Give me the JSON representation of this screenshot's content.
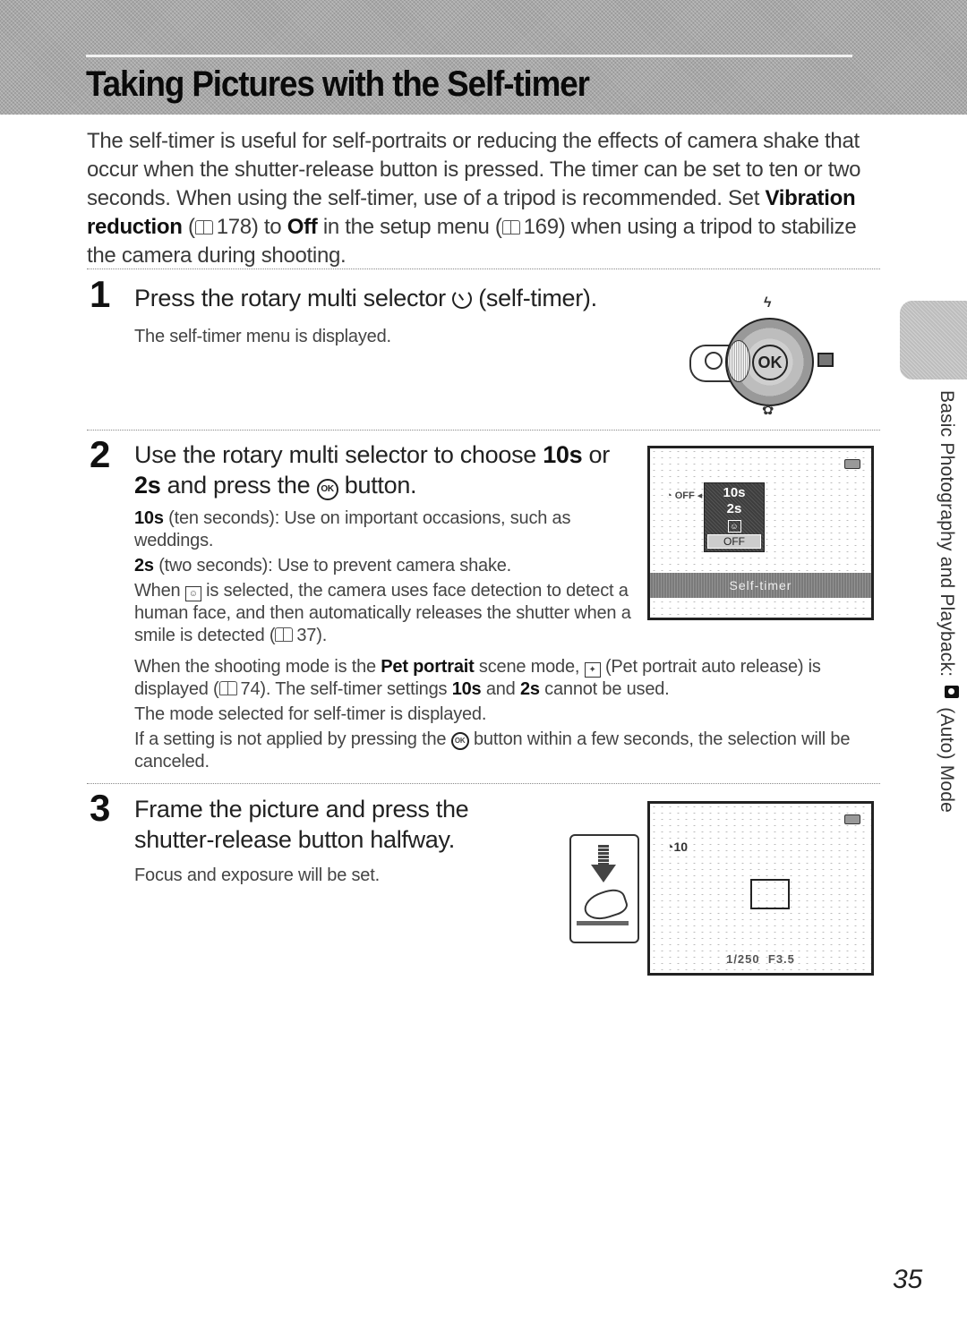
{
  "header": {
    "title": "Taking Pictures with the Self-timer"
  },
  "intro": {
    "line1": "The self-timer is useful for self-portraits or reducing the effects of camera shake that occur when the shutter-release button is pressed. The timer can be set to ten or two seconds. When using the self-timer, use of a tripod is recommended. Set ",
    "vr_label": "Vibration reduction",
    "vr_ref": "178",
    "mid": ") to ",
    "off_label": "Off",
    "setup_text": " in the setup menu (",
    "setup_ref": "169",
    "tail": ") when using a tripod to stabilize the camera during shooting."
  },
  "steps": [
    {
      "number": "1",
      "heading_pre": "Press the rotary multi selector ",
      "heading_post": " (self-timer).",
      "note": "The self-timer menu is displayed.",
      "dial": {
        "center_label": "OK"
      }
    },
    {
      "number": "2",
      "heading_pre": "Use the rotary multi selector to choose ",
      "bold_a": "10s",
      "heading_mid": " or ",
      "bold_b": "2s",
      "heading_post_a": " and press the ",
      "heading_post_b": " button.",
      "notes": {
        "n1_bold": "10s",
        "n1_text": " (ten seconds): Use on important occasions, such as weddings.",
        "n2_bold": "2s",
        "n2_text": " (two seconds): Use to prevent camera shake.",
        "n3_pre": "When ",
        "n3_post": " is selected, the camera uses face detection to detect a human face, and then automatically releases the shutter when a smile is detected (",
        "n3_ref": "37",
        "n3_end": ").",
        "n4_pre": "When the shooting mode is the ",
        "n4_bold": "Pet portrait",
        "n4_mid": " scene mode, ",
        "n4_post": " (Pet portrait auto release) is displayed (",
        "n4_ref": "74",
        "n4_mid2": "). The self-timer settings ",
        "n4_bold2": "10s",
        "n4_and": " and ",
        "n4_bold3": "2s",
        "n4_end": " cannot be used.",
        "n5": "The mode selected for self-timer is displayed.",
        "n6_pre": "If a setting is not applied by pressing the ",
        "n6_post": " button within a few seconds, the selection will be canceled."
      },
      "screen": {
        "side_label": "OFF",
        "menu_items": [
          "10s",
          "2s",
          "smile"
        ],
        "selected": "OFF",
        "bar_label": "Self-timer"
      }
    },
    {
      "number": "3",
      "heading": "Frame the picture and press the shutter-release button halfway.",
      "note": "Focus and exposure will be set.",
      "screen": {
        "timer_readout": "10",
        "shutter_speed": "1/250",
        "aperture": "F3.5"
      }
    }
  ],
  "side_tab": {
    "label_pre": "Basic Photography and Playback: ",
    "label_post": " (Auto) Mode"
  },
  "footer": {
    "page_number": "35"
  }
}
